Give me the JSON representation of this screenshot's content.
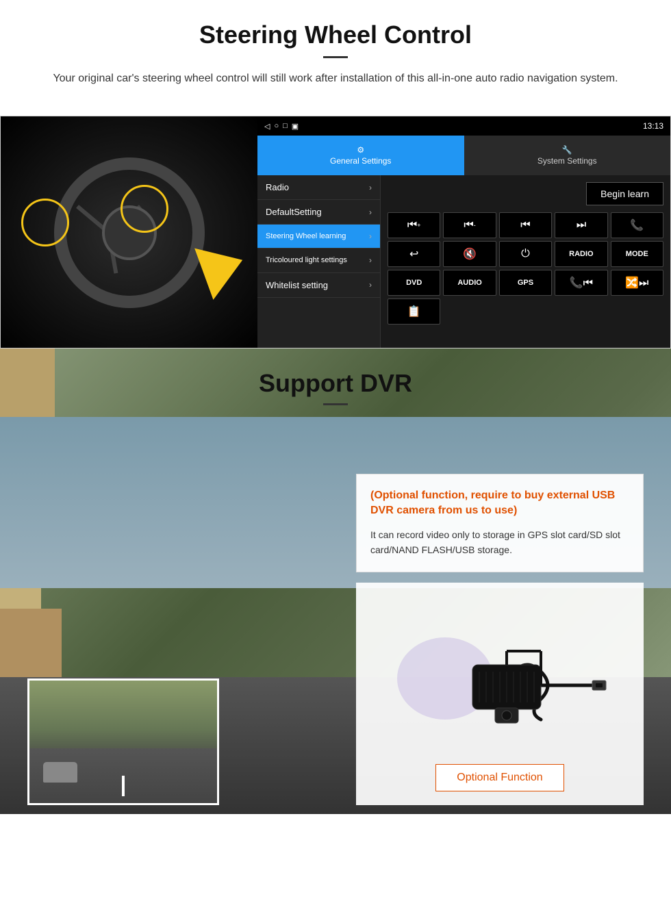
{
  "steering": {
    "title": "Steering Wheel Control",
    "subtitle": "Your original car's steering wheel control will still work after installation of this all-in-one auto radio navigation system.",
    "statusbar": {
      "time": "13:13",
      "icons": [
        "◁",
        "○",
        "□",
        "▣"
      ]
    },
    "tabs": {
      "general": "General Settings",
      "system": "System Settings"
    },
    "menu": {
      "items": [
        {
          "label": "Radio",
          "active": false
        },
        {
          "label": "DefaultSetting",
          "active": false
        },
        {
          "label": "Steering Wheel learning",
          "active": true
        },
        {
          "label": "Tricoloured light settings",
          "active": false
        },
        {
          "label": "Whitelist setting",
          "active": false
        }
      ]
    },
    "begin_learn": "Begin learn",
    "controls": {
      "row1": [
        "⏮+",
        "⏮-",
        "⏮",
        "⏭",
        "📞"
      ],
      "row2": [
        "↩",
        "🔇",
        "⏻",
        "RADIO",
        "MODE"
      ],
      "row3": [
        "DVD",
        "AUDIO",
        "GPS",
        "📞⏮",
        "🔀⏭"
      ],
      "row4": [
        "📋"
      ]
    }
  },
  "dvr": {
    "title": "Support DVR",
    "info_title": "(Optional function, require to buy external USB DVR camera from us to use)",
    "info_body": "It can record video only to storage in GPS slot card/SD slot card/NAND FLASH/USB storage.",
    "optional_button": "Optional Function"
  }
}
